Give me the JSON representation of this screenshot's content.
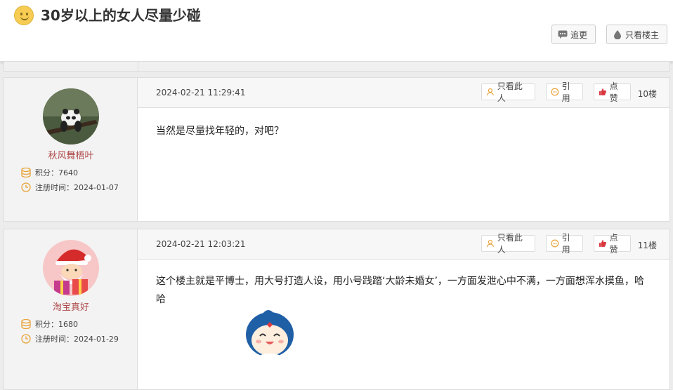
{
  "thread": {
    "title": "30岁以上的女人尽量少碰",
    "follow_label": "追更",
    "only_op_label": "只看楼主"
  },
  "labels": {
    "points": "积分：",
    "reg_time": "注册时间：",
    "only_this_user": "只看此人",
    "quote": "引用",
    "like": "点赞"
  },
  "posts": [
    {
      "username": "秋风舞梧叶",
      "points": "7640",
      "reg_date": "2024-01-07",
      "timestamp": "2024-02-21 11:29:41",
      "floor": "10楼",
      "text": "当然是尽量找年轻的，对吧？"
    },
    {
      "username": "淘宝真好",
      "points": "1680",
      "reg_date": "2024-01-29",
      "timestamp": "2024-02-21 12:03:21",
      "floor": "11楼",
      "text": "这个楼主就是平博士，用大号打造人设，用小号践踏‘大龄未婚女’，一方面发泄心中不满，一方面想浑水摸鱼，哈哈"
    }
  ],
  "colors": {
    "username": "#b04a4a",
    "like_icon": "#d9363e",
    "info_icon": "#e8a33a"
  }
}
